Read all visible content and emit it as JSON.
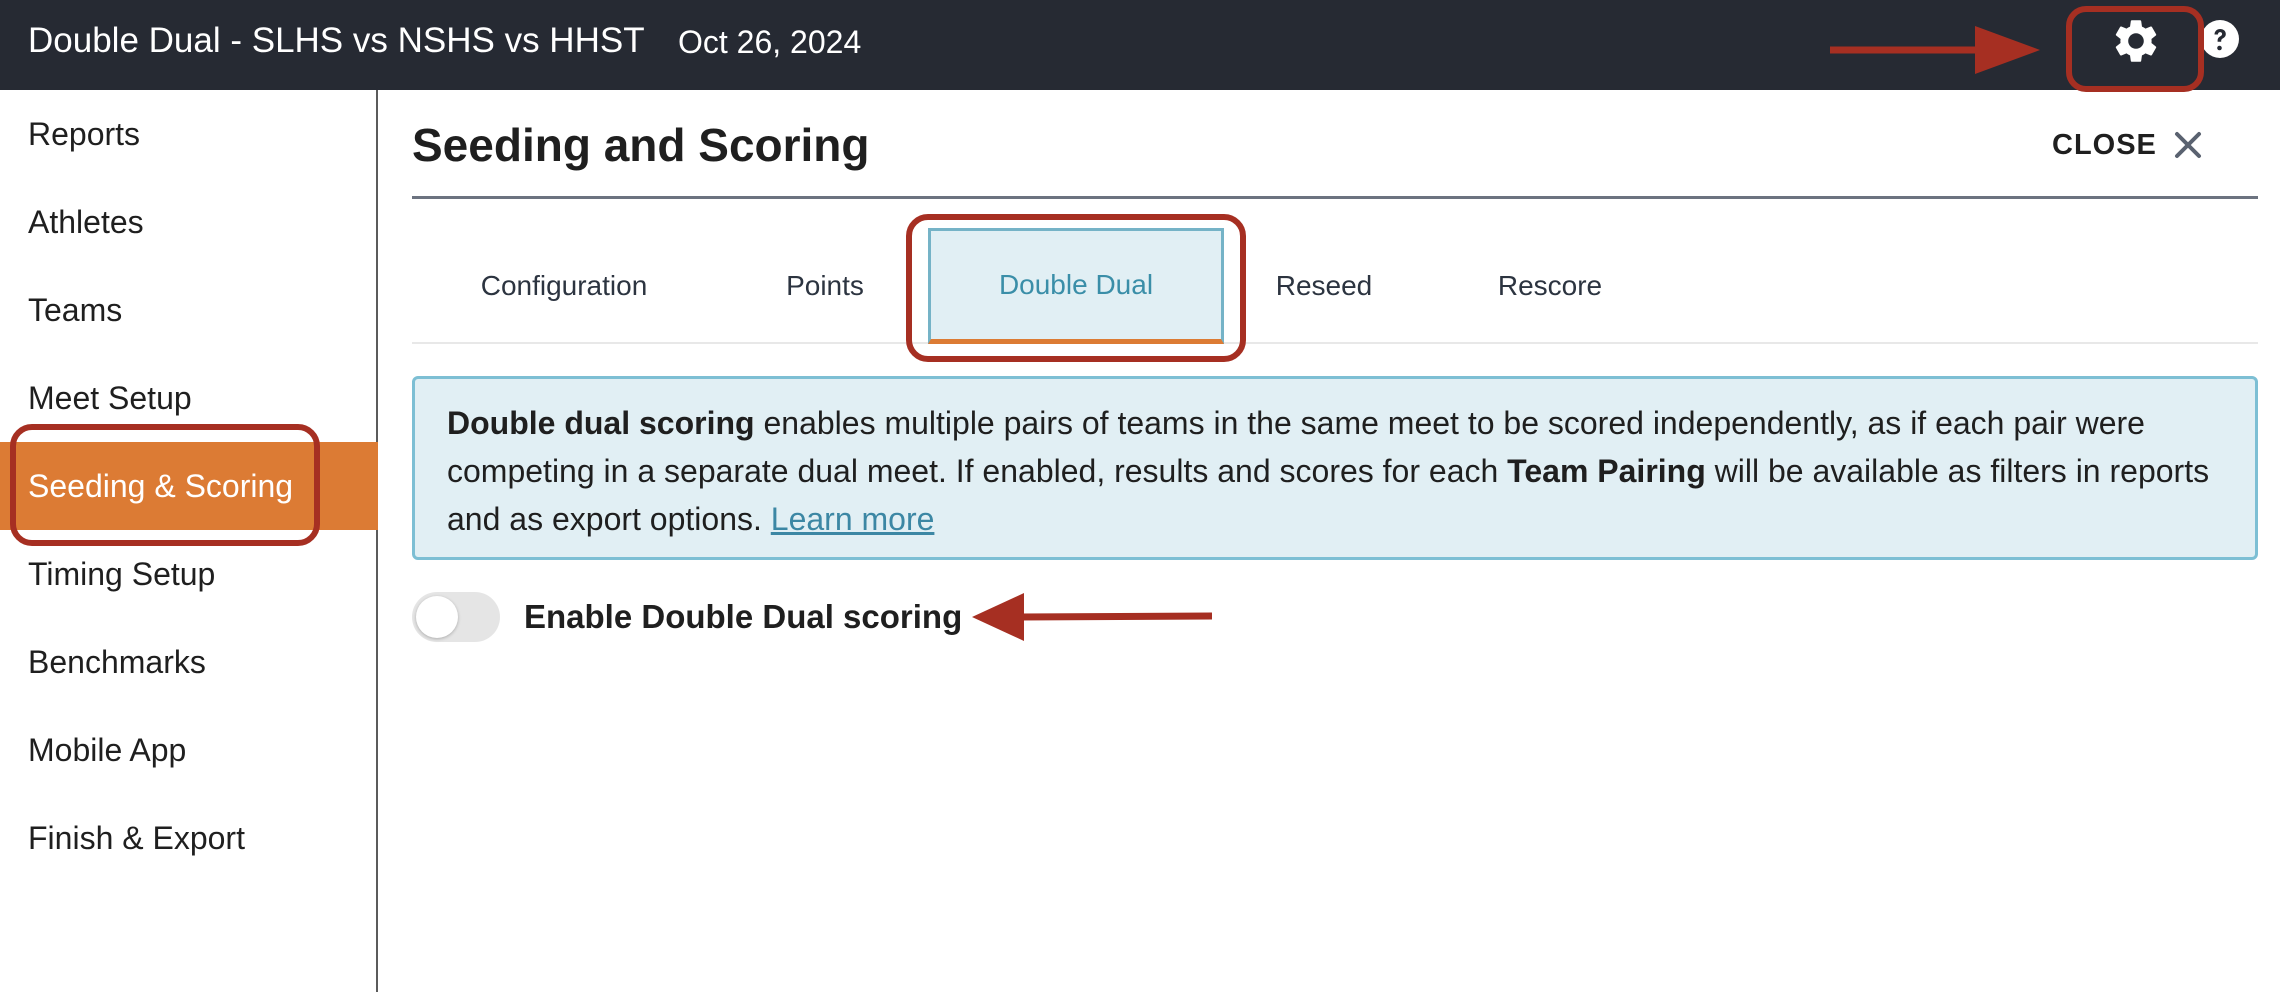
{
  "header": {
    "title": "Double Dual - SLHS vs NSHS vs HHST",
    "date": "Oct 26, 2024",
    "settings_icon": "gear-icon",
    "help_icon": "question-circle-icon",
    "bar_color": "#262a33"
  },
  "sidebar": {
    "items": [
      {
        "label": "Reports"
      },
      {
        "label": "Athletes"
      },
      {
        "label": "Teams"
      },
      {
        "label": "Meet Setup"
      },
      {
        "label": "Seeding & Scoring",
        "active": true
      },
      {
        "label": "Timing Setup"
      },
      {
        "label": "Benchmarks"
      },
      {
        "label": "Mobile App"
      },
      {
        "label": "Finish & Export"
      }
    ],
    "active_color": "#dc7b34"
  },
  "panel": {
    "title": "Seeding and Scoring",
    "close_label": "CLOSE",
    "close_icon": "close-x-icon",
    "tabs": [
      {
        "label": "Configuration"
      },
      {
        "label": "Points"
      },
      {
        "label": "Double Dual",
        "active": true
      },
      {
        "label": "Reseed"
      },
      {
        "label": "Rescore"
      }
    ],
    "info": {
      "term1": "Double dual scoring",
      "text1": " enables multiple pairs of teams in the same meet to be scored independently, as if each pair were competing in a separate dual meet. If enabled, results and scores for each ",
      "term2": "Team Pairing",
      "text2": " will be available as filters in reports and as export options. ",
      "link": "Learn more"
    },
    "toggle": {
      "label": "Enable Double Dual scoring",
      "enabled": false
    }
  },
  "annotations": {
    "highlight_color": "#a62f22"
  }
}
